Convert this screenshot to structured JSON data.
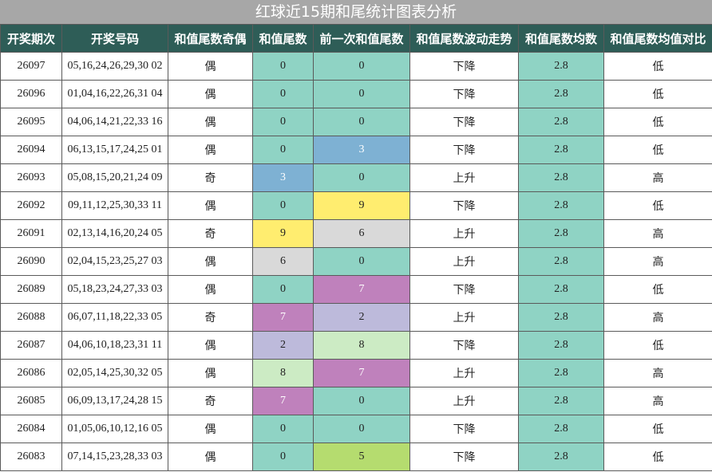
{
  "title": "红球近15期和尾统计图表分析",
  "headers": [
    "开奖期次",
    "开奖号码",
    "和值尾数奇偶",
    "和值尾数",
    "前一次和值尾数",
    "和值尾数波动走势",
    "和值尾数均数",
    "和值尾数均值对比"
  ],
  "colors": {
    "title_bg": "#a7a7a7",
    "header_bg": "#2e5d57",
    "mint": "#8fd3c4",
    "digit_colors": {
      "0": "#8fd3c4",
      "2": "#bdbadb",
      "3": "#7eb1d3",
      "5": "#b5dc6f",
      "6": "#d9d9d9",
      "7": "#bf81bc",
      "8": "#ccebc4",
      "9": "#ffed6f"
    }
  },
  "rows": [
    {
      "period": "26097",
      "numbers": "05,16,24,26,29,30 02",
      "parity": "偶",
      "tail": "0",
      "prev_tail": "0",
      "trend": "下降",
      "avg": "2.8",
      "compare": "低"
    },
    {
      "period": "26096",
      "numbers": "01,04,16,22,26,31 04",
      "parity": "偶",
      "tail": "0",
      "prev_tail": "0",
      "trend": "下降",
      "avg": "2.8",
      "compare": "低"
    },
    {
      "period": "26095",
      "numbers": "04,06,14,21,22,33 16",
      "parity": "偶",
      "tail": "0",
      "prev_tail": "0",
      "trend": "下降",
      "avg": "2.8",
      "compare": "低"
    },
    {
      "period": "26094",
      "numbers": "06,13,15,17,24,25 01",
      "parity": "偶",
      "tail": "0",
      "prev_tail": "3",
      "trend": "下降",
      "avg": "2.8",
      "compare": "低"
    },
    {
      "period": "26093",
      "numbers": "05,08,15,20,21,24 09",
      "parity": "奇",
      "tail": "3",
      "prev_tail": "0",
      "trend": "上升",
      "avg": "2.8",
      "compare": "高"
    },
    {
      "period": "26092",
      "numbers": "09,11,12,25,30,33 11",
      "parity": "偶",
      "tail": "0",
      "prev_tail": "9",
      "trend": "下降",
      "avg": "2.8",
      "compare": "低"
    },
    {
      "period": "26091",
      "numbers": "02,13,14,16,20,24 05",
      "parity": "奇",
      "tail": "9",
      "prev_tail": "6",
      "trend": "上升",
      "avg": "2.8",
      "compare": "高"
    },
    {
      "period": "26090",
      "numbers": "02,04,15,23,25,27 03",
      "parity": "偶",
      "tail": "6",
      "prev_tail": "0",
      "trend": "上升",
      "avg": "2.8",
      "compare": "高"
    },
    {
      "period": "26089",
      "numbers": "05,18,23,24,27,33 03",
      "parity": "偶",
      "tail": "0",
      "prev_tail": "7",
      "trend": "下降",
      "avg": "2.8",
      "compare": "低"
    },
    {
      "period": "26088",
      "numbers": "06,07,11,18,22,33 05",
      "parity": "奇",
      "tail": "7",
      "prev_tail": "2",
      "trend": "上升",
      "avg": "2.8",
      "compare": "高"
    },
    {
      "period": "26087",
      "numbers": "04,06,10,18,23,31 11",
      "parity": "偶",
      "tail": "2",
      "prev_tail": "8",
      "trend": "下降",
      "avg": "2.8",
      "compare": "低"
    },
    {
      "period": "26086",
      "numbers": "02,05,14,25,30,32 05",
      "parity": "偶",
      "tail": "8",
      "prev_tail": "7",
      "trend": "上升",
      "avg": "2.8",
      "compare": "高"
    },
    {
      "period": "26085",
      "numbers": "06,09,13,17,24,28 15",
      "parity": "奇",
      "tail": "7",
      "prev_tail": "0",
      "trend": "上升",
      "avg": "2.8",
      "compare": "高"
    },
    {
      "period": "26084",
      "numbers": "01,05,06,10,12,16 05",
      "parity": "偶",
      "tail": "0",
      "prev_tail": "0",
      "trend": "下降",
      "avg": "2.8",
      "compare": "低"
    },
    {
      "period": "26083",
      "numbers": "07,14,15,23,28,33 03",
      "parity": "偶",
      "tail": "0",
      "prev_tail": "5",
      "trend": "下降",
      "avg": "2.8",
      "compare": "低"
    }
  ]
}
